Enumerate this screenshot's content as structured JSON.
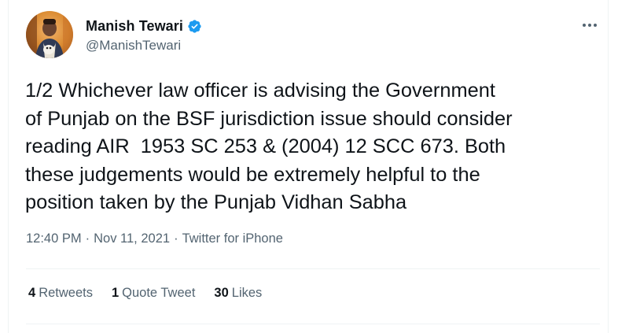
{
  "author": {
    "display_name": "Manish Tewari",
    "handle": "@ManishTewari",
    "verified": true
  },
  "tweet": {
    "text": "1/2 Whichever law officer is advising the Government\nof Punjab on the BSF jurisdiction issue should consider\nreading AIR  1953 SC 253 & (2004) 12 SCC 673. Both\nthese judgements would be extremely helpful to the\nposition taken by the Punjab Vidhan Sabha",
    "time": "12:40 PM",
    "date": "Nov 11, 2021",
    "source": "Twitter for iPhone",
    "separator": "·"
  },
  "stats": [
    {
      "count": "4",
      "label": "Retweets"
    },
    {
      "count": "1",
      "label": "Quote Tweet"
    },
    {
      "count": "30",
      "label": "Likes"
    }
  ],
  "colors": {
    "text_primary": "#0f1419",
    "text_secondary": "#536471",
    "verified_blue": "#1d9bf0",
    "divider": "#eff3f4"
  },
  "icons": {
    "verified": "verified-badge-icon",
    "more": "more-options-icon"
  }
}
